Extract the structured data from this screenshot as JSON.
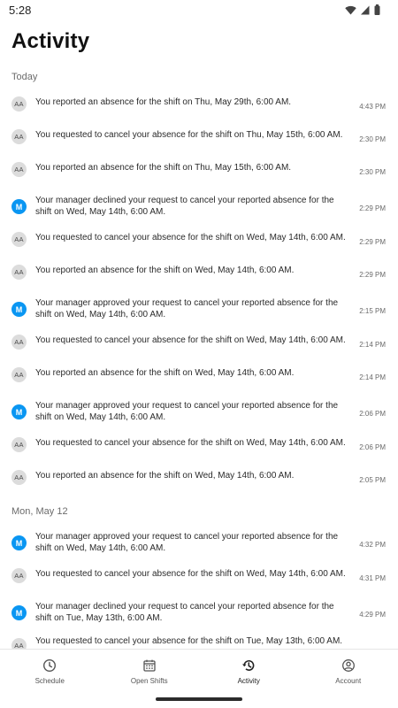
{
  "status_bar": {
    "time": "5:28"
  },
  "header": {
    "title": "Activity"
  },
  "sections": [
    {
      "label": "Today",
      "items": [
        {
          "avatar": "AA",
          "avatar_type": "aa",
          "lines": 1,
          "text": "You reported an absence for the shift on Thu, May 29th, 6:00 AM.",
          "time": "4:43 PM"
        },
        {
          "avatar": "AA",
          "avatar_type": "aa",
          "lines": 1,
          "text": "You requested to cancel your absence for the shift on Thu, May 15th, 6:00 AM.",
          "time": "2:30 PM"
        },
        {
          "avatar": "AA",
          "avatar_type": "aa",
          "lines": 1,
          "text": "You reported an absence for the shift on Thu, May 15th, 6:00 AM.",
          "time": "2:30 PM"
        },
        {
          "avatar": "M",
          "avatar_type": "m",
          "lines": 2,
          "text": "Your manager declined your request to cancel your reported absence for the shift on Wed, May 14th, 6:00 AM.",
          "time": "2:29 PM"
        },
        {
          "avatar": "AA",
          "avatar_type": "aa",
          "lines": 1,
          "text": "You requested to cancel your absence for the shift on Wed, May 14th, 6:00 AM.",
          "time": "2:29 PM"
        },
        {
          "avatar": "AA",
          "avatar_type": "aa",
          "lines": 1,
          "text": "You reported an absence for the shift on Wed, May 14th, 6:00 AM.",
          "time": "2:29 PM"
        },
        {
          "avatar": "M",
          "avatar_type": "m",
          "lines": 2,
          "text": "Your manager approved your request to cancel your reported absence for the shift on Wed, May 14th, 6:00 AM.",
          "time": "2:15 PM"
        },
        {
          "avatar": "AA",
          "avatar_type": "aa",
          "lines": 1,
          "text": "You requested to cancel your absence for the shift on Wed, May 14th, 6:00 AM.",
          "time": "2:14 PM"
        },
        {
          "avatar": "AA",
          "avatar_type": "aa",
          "lines": 1,
          "text": "You reported an absence for the shift on Wed, May 14th, 6:00 AM.",
          "time": "2:14 PM"
        },
        {
          "avatar": "M",
          "avatar_type": "m",
          "lines": 2,
          "text": "Your manager approved your request to cancel your reported absence for the shift on Wed, May 14th, 6:00 AM.",
          "time": "2:06 PM"
        },
        {
          "avatar": "AA",
          "avatar_type": "aa",
          "lines": 1,
          "text": "You requested to cancel your absence for the shift on Wed, May 14th, 6:00 AM.",
          "time": "2:06 PM"
        },
        {
          "avatar": "AA",
          "avatar_type": "aa",
          "lines": 1,
          "text": "You reported an absence for the shift on Wed, May 14th, 6:00 AM.",
          "time": "2:05 PM"
        }
      ]
    },
    {
      "label": "Mon, May 12",
      "items": [
        {
          "avatar": "M",
          "avatar_type": "m",
          "lines": 2,
          "text": "Your manager approved your request to cancel your reported absence for the shift on Wed, May 14th, 6:00 AM.",
          "time": "4:32 PM"
        },
        {
          "avatar": "AA",
          "avatar_type": "aa",
          "lines": 1,
          "text": "You requested to cancel your absence for the shift on Wed, May 14th, 6:00 AM.",
          "time": "4:31 PM"
        },
        {
          "avatar": "M",
          "avatar_type": "m",
          "lines": 2,
          "text": "Your manager declined your request to cancel your reported absence for the shift on Tue, May 13th, 6:00 AM.",
          "time": "4:29 PM"
        },
        {
          "avatar": "AA",
          "avatar_type": "aa",
          "lines": 1,
          "partial": true,
          "text": "You requested to cancel your absence for the shift on Tue, May 13th, 6:00 AM.",
          "time": ""
        }
      ]
    }
  ],
  "bottom_nav": [
    {
      "label": "Schedule",
      "icon": "clock-icon",
      "active": false
    },
    {
      "label": "Open Shifts",
      "icon": "calendar-icon",
      "active": false
    },
    {
      "label": "Activity",
      "icon": "history-icon",
      "active": true
    },
    {
      "label": "Account",
      "icon": "account-icon",
      "active": false
    }
  ],
  "colors": {
    "manager_avatar": "#0a96f2",
    "user_avatar": "#dcdcdc"
  }
}
